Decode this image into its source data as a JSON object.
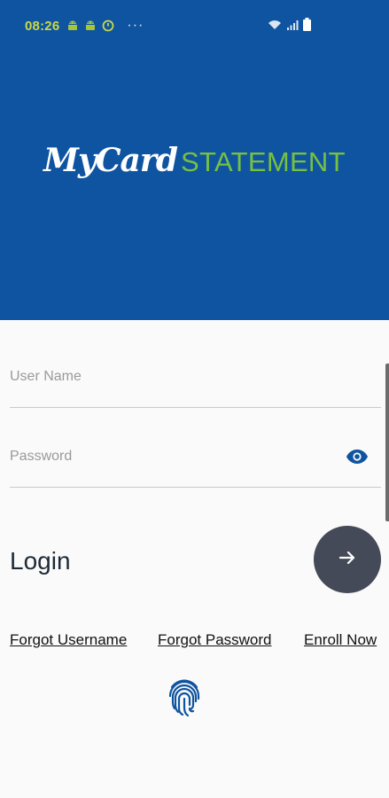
{
  "status_bar": {
    "time": "08:26",
    "more_indicator": "···",
    "icons": [
      "android-icon",
      "android-icon",
      "alarm-icon",
      "wifi-icon",
      "signal-icon",
      "battery-icon"
    ]
  },
  "logo": {
    "part1": "MyCard",
    "part2": "STATEMENT"
  },
  "form": {
    "username_placeholder": "User Name",
    "username_value": "",
    "password_placeholder": "Password",
    "password_value": ""
  },
  "login": {
    "label": "Login"
  },
  "links": {
    "forgot_username": "Forgot Username",
    "forgot_password": "Forgot Password",
    "enroll_now": "Enroll Now"
  },
  "colors": {
    "header_bg": "#0f54a0",
    "logo_green": "#76c043",
    "button_bg": "#454a59",
    "accent_blue": "#0f54a0"
  }
}
